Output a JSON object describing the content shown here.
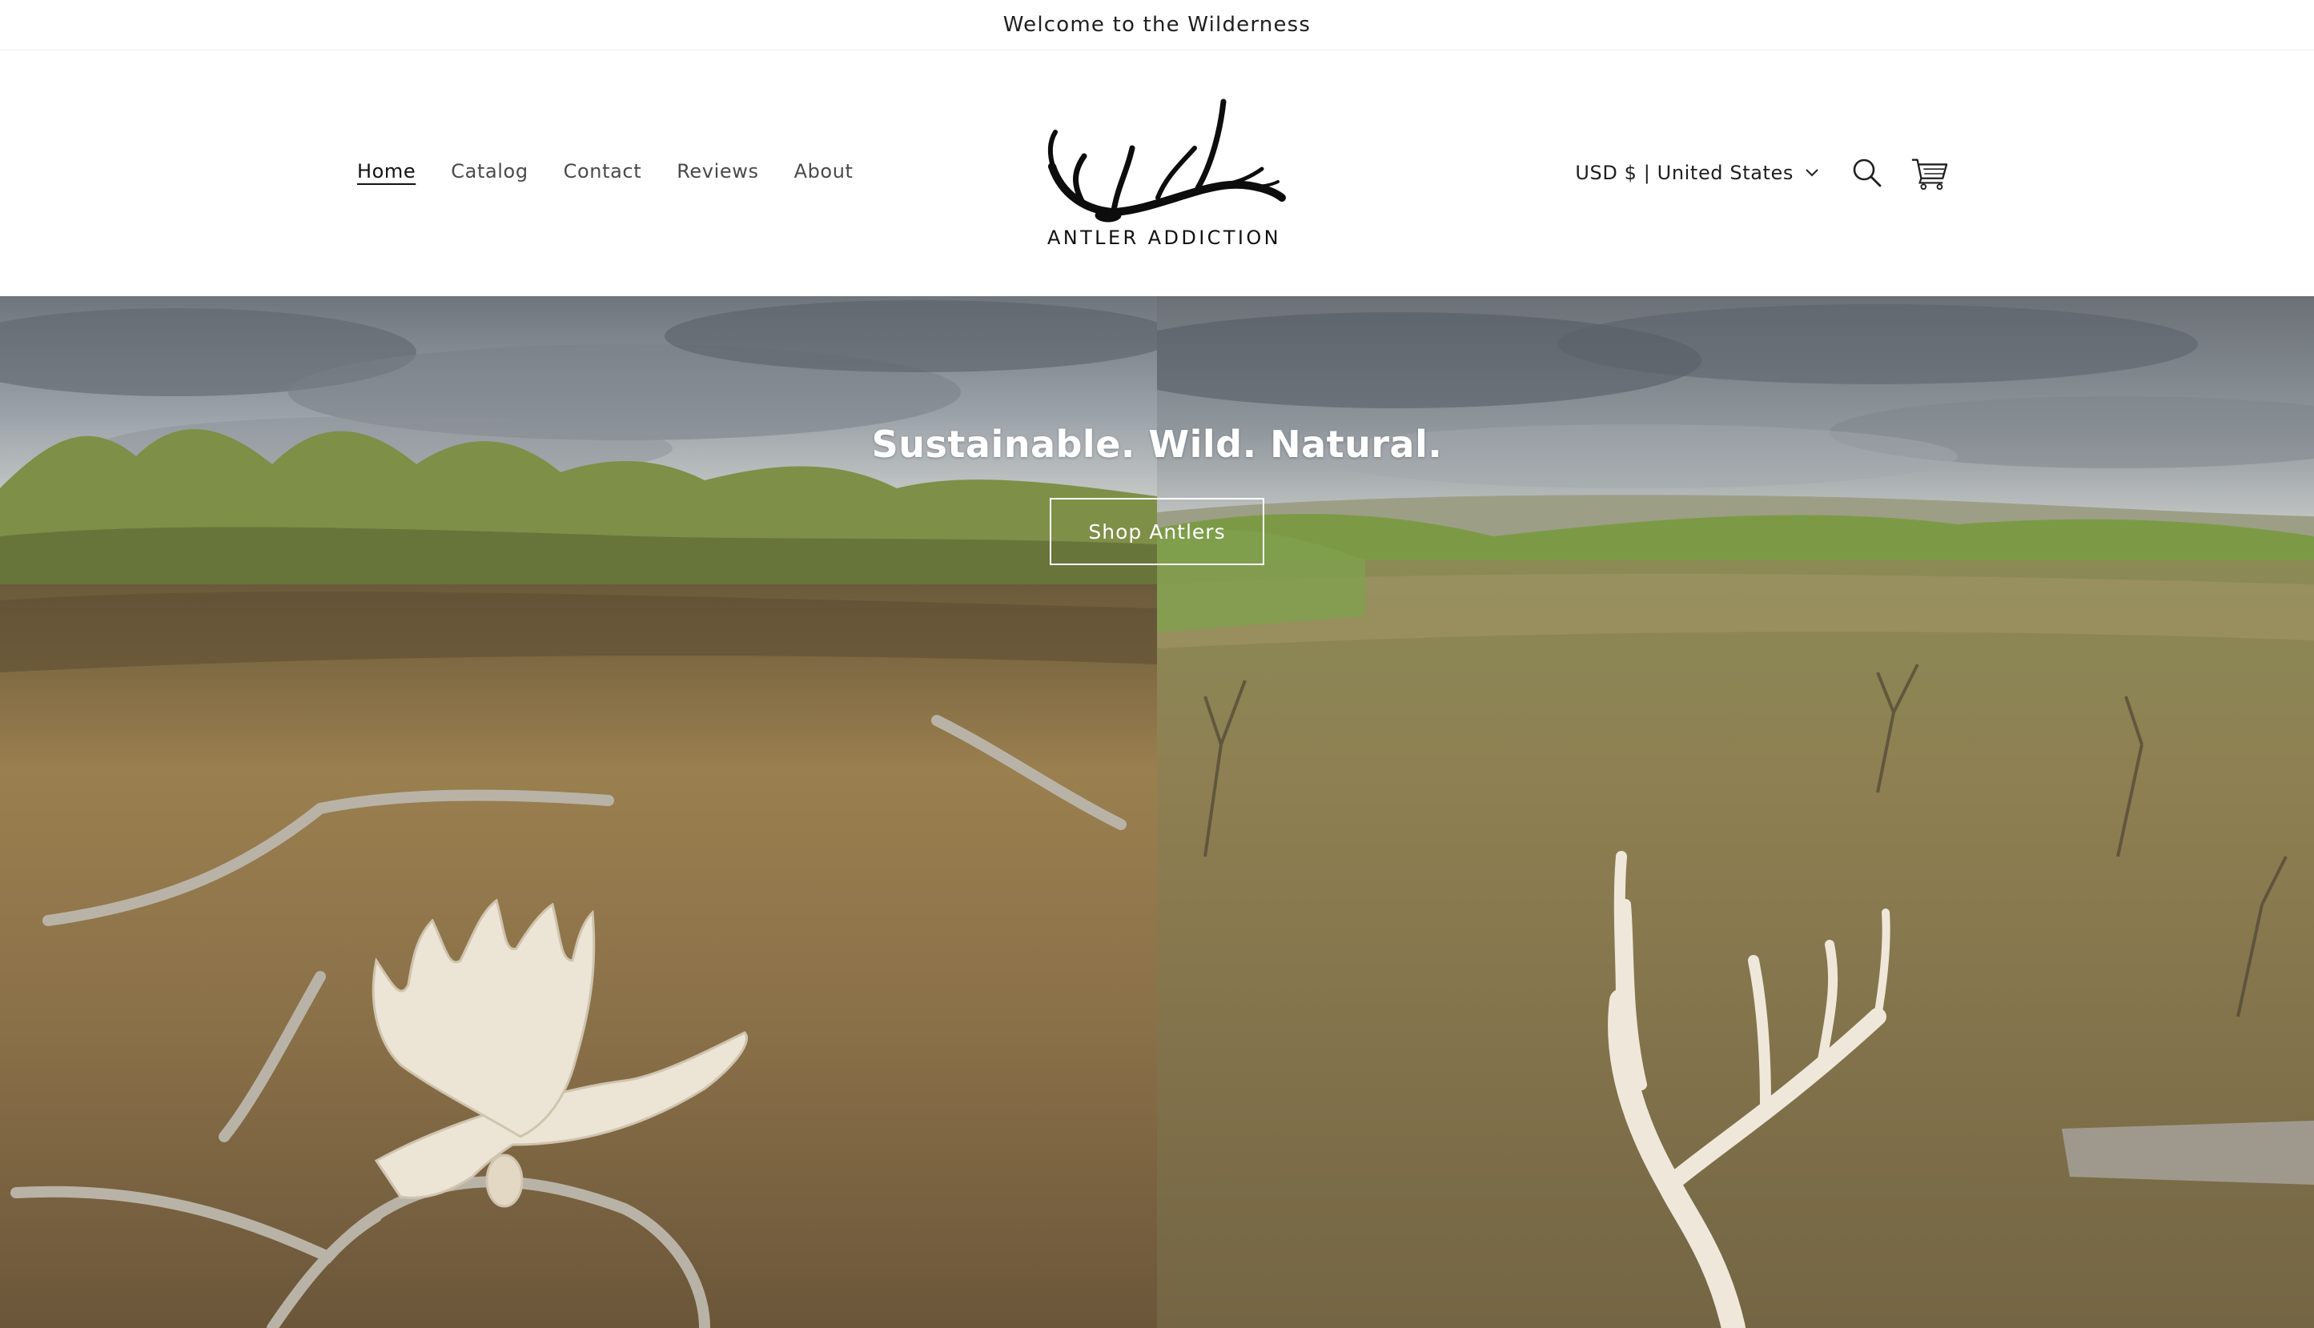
{
  "announcement": {
    "text": "Welcome to the Wilderness"
  },
  "header": {
    "nav": [
      {
        "label": "Home",
        "active": true
      },
      {
        "label": "Catalog"
      },
      {
        "label": "Contact"
      },
      {
        "label": "Reviews"
      },
      {
        "label": "About"
      }
    ],
    "logo": {
      "text": "ANTLER ADDICTION",
      "icon": "elk-antler-logo"
    },
    "currency": {
      "selected": "USD $ | United States",
      "icon": "chevron-down-icon"
    },
    "icons": {
      "search": "search-icon",
      "cart": "cart-icon"
    }
  },
  "hero": {
    "heading": "Sustainable. Wild. Natural.",
    "button_label": "Shop Antlers",
    "left_image": "moose-antler-in-grass",
    "right_image": "deer-antler-on-prairie"
  },
  "colors": {
    "background": "#ffffff",
    "text": "#1a1a1a",
    "nav_text": "#4a4a4a",
    "hero_text": "#ffffff"
  }
}
